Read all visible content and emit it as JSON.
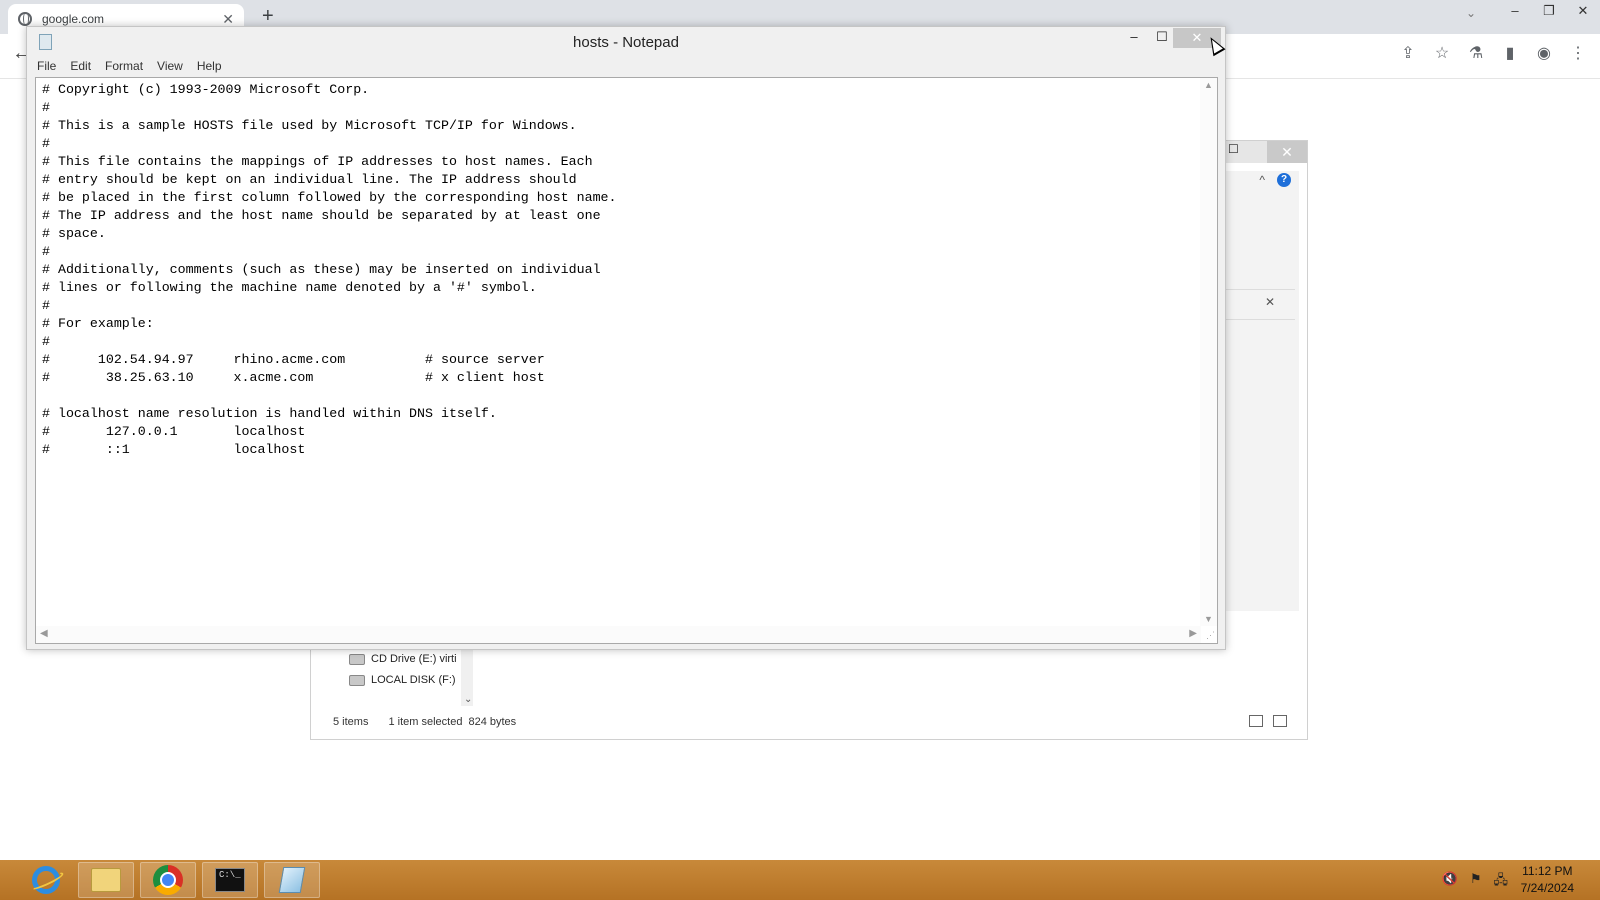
{
  "browser": {
    "tab_title": "google.com",
    "tab_close": "✕",
    "new_tab": "+",
    "back": "←",
    "window_controls": [
      "⌄",
      "–",
      "❐",
      "✕"
    ],
    "toolbar_icons": [
      "⇪",
      "☆",
      "⚗",
      "▮",
      "◉",
      "⋮"
    ]
  },
  "explorer": {
    "maximize": "☐",
    "close": "✕",
    "collapse": "^",
    "help": "?",
    "search_clear": "✕",
    "nav_items": [
      {
        "label": "CD Drive (E:) virti"
      },
      {
        "label": "LOCAL DISK (F:)"
      }
    ],
    "scroll_down": "⌄",
    "status": {
      "items": "5 items",
      "selected": "1 item selected",
      "size": "824 bytes"
    }
  },
  "notepad": {
    "title": "hosts - Notepad",
    "minimize": "–",
    "maximize": "☐",
    "close": "✕",
    "menu": [
      "File",
      "Edit",
      "Format",
      "View",
      "Help"
    ],
    "content": "# Copyright (c) 1993-2009 Microsoft Corp.\n#\n# This is a sample HOSTS file used by Microsoft TCP/IP for Windows.\n#\n# This file contains the mappings of IP addresses to host names. Each\n# entry should be kept on an individual line. The IP address should\n# be placed in the first column followed by the corresponding host name.\n# The IP address and the host name should be separated by at least one\n# space.\n#\n# Additionally, comments (such as these) may be inserted on individual\n# lines or following the machine name denoted by a '#' symbol.\n#\n# For example:\n#\n#      102.54.94.97     rhino.acme.com          # source server\n#       38.25.63.10     x.acme.com              # x client host\n\n# localhost name resolution is handled within DNS itself.\n#\t127.0.0.1       localhost\n#\t::1             localhost"
  },
  "taskbar": {
    "apps": [
      "internet-explorer",
      "file-explorer",
      "chrome",
      "command-prompt",
      "notepad"
    ],
    "cmd_label": "C:\\_",
    "tray_icons": [
      "🔇",
      "⚑",
      "🖧"
    ],
    "time": "11:12 PM",
    "date": "7/24/2024"
  }
}
